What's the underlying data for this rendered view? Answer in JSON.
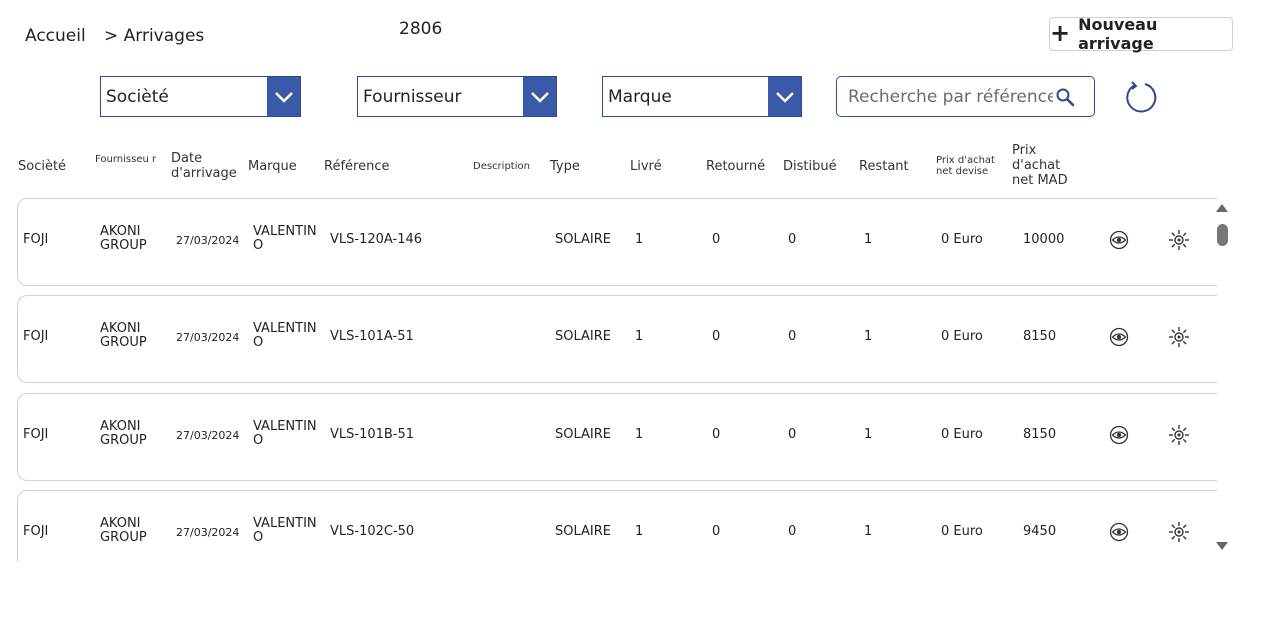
{
  "breadcrumb": {
    "home": "Accueil",
    "current": "> Arrivages"
  },
  "count": "2806",
  "new_button": {
    "label": "Nouveau arrivage",
    "icon": "plus-icon"
  },
  "filters": {
    "societe": "Socièté",
    "fournisseur": "Fournisseur",
    "marque": "Marque",
    "search_placeholder": "Recherche par référence"
  },
  "columns": {
    "societe": "Socièté",
    "fournisseur": "Fournisseu r",
    "date": "Date d'arrivage",
    "marque": "Marque",
    "reference": "Référence",
    "description": "Description",
    "type": "Type",
    "livre": "Livré",
    "retourne": "Retourné",
    "distribue": "Distibué",
    "restant": "Restant",
    "prix_devise": "Prix d'achat net devise",
    "prix_mad": "Prix d'achat net MAD"
  },
  "rows": [
    {
      "societe": "FOJI",
      "fournisseur": "AKONI GROUP",
      "date": "27/03/2024",
      "marque": "VALENTIN O",
      "reference": "VLS-120A-146",
      "type": "SOLAIRE",
      "livre": "1",
      "retourne": "0",
      "distribue": "0",
      "restant": "1",
      "prix_devise": "0 Euro",
      "prix_mad": "10000"
    },
    {
      "societe": "FOJI",
      "fournisseur": "AKONI GROUP",
      "date": "27/03/2024",
      "marque": "VALENTIN O",
      "reference": "VLS-101A-51",
      "type": "SOLAIRE",
      "livre": "1",
      "retourne": "0",
      "distribue": "0",
      "restant": "1",
      "prix_devise": "0 Euro",
      "prix_mad": "8150"
    },
    {
      "societe": "FOJI",
      "fournisseur": "AKONI GROUP",
      "date": "27/03/2024",
      "marque": "VALENTIN O",
      "reference": "VLS-101B-51",
      "type": "SOLAIRE",
      "livre": "1",
      "retourne": "0",
      "distribue": "0",
      "restant": "1",
      "prix_devise": "0 Euro",
      "prix_mad": "8150"
    },
    {
      "societe": "FOJI",
      "fournisseur": "AKONI GROUP",
      "date": "27/03/2024",
      "marque": "VALENTIN O",
      "reference": "VLS-102C-50",
      "type": "SOLAIRE",
      "livre": "1",
      "retourne": "0",
      "distribue": "0",
      "restant": "1",
      "prix_devise": "0 Euro",
      "prix_mad": "9450"
    }
  ],
  "icons": {
    "view": "eye-icon",
    "settings": "gear-icon",
    "refresh": "refresh-icon",
    "search": "search-icon",
    "dropdown": "chevron-down-icon"
  },
  "colors": {
    "accent": "#3a5aa8",
    "border": "#2d4a8e"
  }
}
